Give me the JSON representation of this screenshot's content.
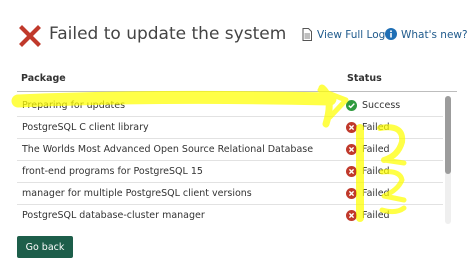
{
  "header": {
    "title": "Failed to update the system",
    "view_log_label": "View Full Log",
    "whats_new_label": "What's new?"
  },
  "table": {
    "col_package": "Package",
    "col_status": "Status",
    "rows": [
      {
        "name": "Preparing for updates",
        "status": "Success",
        "state": "success"
      },
      {
        "name": "PostgreSQL C client library",
        "status": "Failed",
        "state": "failed"
      },
      {
        "name": "The Worlds Most Advanced Open Source Relational Database",
        "status": "Failed",
        "state": "failed"
      },
      {
        "name": "front-end programs for PostgreSQL 15",
        "status": "Failed",
        "state": "failed"
      },
      {
        "name": "manager for multiple PostgreSQL client versions",
        "status": "Failed",
        "state": "failed"
      },
      {
        "name": "PostgreSQL database-cluster manager",
        "status": "Failed",
        "state": "failed"
      }
    ]
  },
  "footer": {
    "go_back_label": "Go back"
  },
  "colors": {
    "error_red": "#c0392b",
    "success_green": "#2e9a3e",
    "link_blue": "#1f5a8c",
    "button_green": "#1d5e4a",
    "highlighter_yellow": "#ffff00"
  },
  "icons": {
    "title": "close-x-icon",
    "log": "document-icon",
    "info": "info-icon",
    "success": "check-circle-icon",
    "failed": "x-circle-icon"
  }
}
